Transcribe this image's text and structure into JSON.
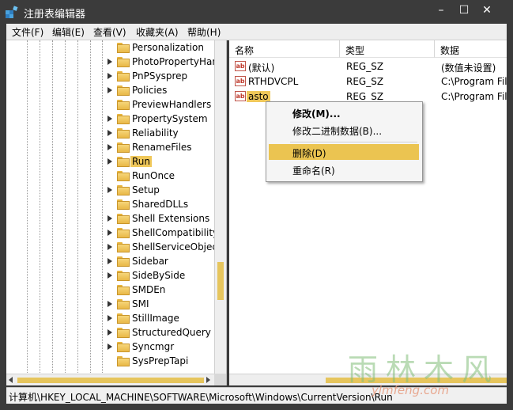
{
  "window": {
    "title": "注册表编辑器",
    "min": "–",
    "max": "☐",
    "close": "✕"
  },
  "menu": [
    "文件(F)",
    "编辑(E)",
    "查看(V)",
    "收藏夹(A)",
    "帮助(H)"
  ],
  "tree": {
    "items": [
      {
        "label": "Personalization",
        "expandable": false
      },
      {
        "label": "PhotoPropertyHan",
        "expandable": true
      },
      {
        "label": "PnPSysprep",
        "expandable": true
      },
      {
        "label": "Policies",
        "expandable": true
      },
      {
        "label": "PreviewHandlers",
        "expandable": false
      },
      {
        "label": "PropertySystem",
        "expandable": true
      },
      {
        "label": "Reliability",
        "expandable": true
      },
      {
        "label": "RenameFiles",
        "expandable": true
      },
      {
        "label": "Run",
        "expandable": true,
        "selected": true
      },
      {
        "label": "RunOnce",
        "expandable": false
      },
      {
        "label": "Setup",
        "expandable": true
      },
      {
        "label": "SharedDLLs",
        "expandable": false
      },
      {
        "label": "Shell Extensions",
        "expandable": true
      },
      {
        "label": "ShellCompatibility",
        "expandable": true
      },
      {
        "label": "ShellServiceObjectI",
        "expandable": true
      },
      {
        "label": "Sidebar",
        "expandable": true
      },
      {
        "label": "SideBySide",
        "expandable": true
      },
      {
        "label": "SMDEn",
        "expandable": false
      },
      {
        "label": "SMI",
        "expandable": true
      },
      {
        "label": "StillImage",
        "expandable": true
      },
      {
        "label": "StructuredQuery",
        "expandable": true
      },
      {
        "label": "Syncmgr",
        "expandable": true
      },
      {
        "label": "SysPrepTapi",
        "expandable": false
      }
    ]
  },
  "list": {
    "headers": {
      "name": "名称",
      "type": "类型",
      "data": "数据"
    },
    "rows": [
      {
        "name": "(默认)",
        "type": "REG_SZ",
        "data": "(数值未设置)"
      },
      {
        "name": "RTHDVCPL",
        "type": "REG_SZ",
        "data": "C:\\Program File"
      },
      {
        "name": "asto",
        "type": "REG_SZ",
        "data": "C:\\Program File",
        "selected": true
      }
    ],
    "icon_text": "ab"
  },
  "context_menu": {
    "modify": "修改(M)...",
    "modify_binary": "修改二进制数据(B)...",
    "delete": "删除(D)",
    "rename": "重命名(R)"
  },
  "status": {
    "path": "计算机\\HKEY_LOCAL_MACHINE\\SOFTWARE\\Microsoft\\Windows\\CurrentVersion\\Run"
  },
  "watermark": {
    "main": "雨林木风",
    "sub": "ylmfeng.com"
  },
  "colors": {
    "selection": "#f0c85a",
    "menu_hover": "#ebc451",
    "frame": "#3b3b3b"
  }
}
